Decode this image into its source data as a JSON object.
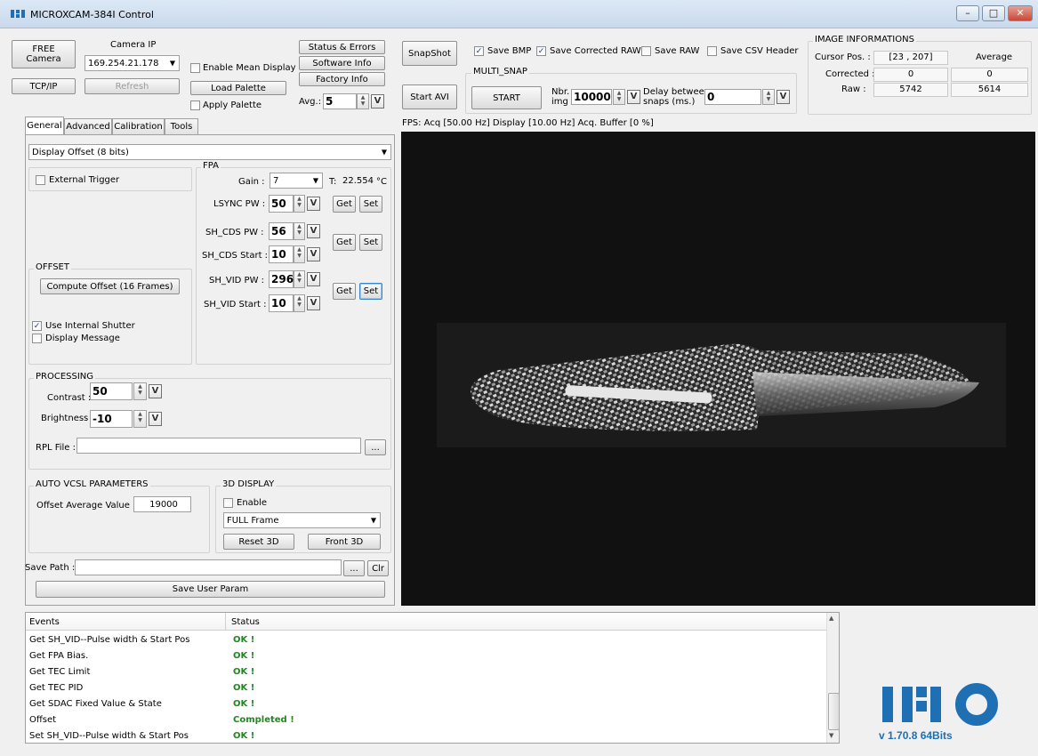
{
  "window": {
    "title": "MICROXCAM-384I Control",
    "minimize": "–",
    "maximize": "□",
    "close": "✕"
  },
  "camera": {
    "free_label": "FREE\nCamera",
    "ip_label": "Camera IP",
    "ip_value": "169.254.21.178",
    "tcpip_label": "TCP/IP",
    "refresh_label": "Refresh"
  },
  "top_buttons": {
    "status_errors": "Status & Errors",
    "software_info": "Software Info",
    "factory_info": "Factory Info",
    "load_palette": "Load Palette",
    "enable_mean": "Enable Mean Display",
    "apply_palette": "Apply Palette",
    "avg_label": "Avg.:",
    "avg_value": "5"
  },
  "snap": {
    "snapshot": "SnapShot",
    "start_avi": "Start AVI",
    "save_bmp": "Save BMP",
    "save_corrected_raw": "Save Corrected RAW",
    "save_raw": "Save RAW",
    "save_csv_header": "Save CSV Header",
    "multi_snap": "MULTI_SNAP",
    "start": "START",
    "nbr_img_label": "Nbr.\nimg",
    "nbr_img_value": "10000",
    "delay_label": "Delay between\nsnaps (ms.)",
    "delay_value": "0"
  },
  "image_info": {
    "title": "IMAGE INFORMATIONS",
    "cursor_label": "Cursor Pos. :",
    "cursor_value": "[23 , 207]",
    "average_label": "Average",
    "corrected_label": "Corrected :",
    "corrected_value": "0",
    "corrected_avg": "0",
    "raw_label": "Raw :",
    "raw_value": "5742",
    "raw_avg": "5614"
  },
  "fps": "FPS: Acq [50.00 Hz]   Display [10.00 Hz]   Acq. Buffer [0 %]",
  "tabs": [
    "General",
    "Advanced",
    "Calibration",
    "Tools"
  ],
  "display_mode": "Display Offset (8 bits)",
  "external_trigger": "External Trigger",
  "fpa": {
    "title": "FPA",
    "gain_label": "Gain :",
    "gain_value": "7",
    "temp_label": "T:",
    "temp_value": "22.554",
    "temp_unit": "°C",
    "lsync_label": "LSYNC PW :",
    "lsync_value": "50",
    "shcds_pw_label": "SH_CDS PW :",
    "shcds_pw_value": "56",
    "shcds_start_label": "SH_CDS Start :",
    "shcds_start_value": "10",
    "shvid_pw_label": "SH_VID PW :",
    "shvid_pw_value": "296",
    "shvid_start_label": "SH_VID Start :",
    "shvid_start_value": "10",
    "get": "Get",
    "set": "Set",
    "v": "V"
  },
  "offset": {
    "title": "OFFSET",
    "compute": "Compute Offset (16 Frames)",
    "use_internal_shutter": "Use Internal Shutter",
    "display_message": "Display Message"
  },
  "processing": {
    "title": "PROCESSING",
    "contrast_label": "Contrast :",
    "contrast_value": "50",
    "brightness_label": "Brightness :",
    "brightness_value": "-10",
    "rpl_label": "RPL File :",
    "rpl_value": "",
    "browse": "..."
  },
  "auto_vcsl": {
    "title": "AUTO VCSL PARAMETERS",
    "offset_avg_label": "Offset Average Value :",
    "offset_avg_value": "19000"
  },
  "display3d": {
    "title": "3D DISPLAY",
    "enable": "Enable",
    "frame": "FULL Frame",
    "reset": "Reset 3D",
    "front": "Front 3D"
  },
  "save": {
    "path_label": "Save Path :",
    "path_value": "",
    "browse": "...",
    "clr": "Clr",
    "save_user_param": "Save User Param"
  },
  "events": {
    "col_events": "Events",
    "col_status": "Status",
    "rows": [
      {
        "event": "Get SH_VID--Pulse width & Start Pos",
        "status": "OK !"
      },
      {
        "event": "Get FPA Bias.",
        "status": "OK !"
      },
      {
        "event": "Get TEC Limit",
        "status": "OK !"
      },
      {
        "event": "Get TEC PID",
        "status": "OK !"
      },
      {
        "event": "Get SDAC Fixed Value & State",
        "status": "OK !"
      },
      {
        "event": "Offset",
        "status": "Completed !"
      },
      {
        "event": "Set SH_VID--Pulse width & Start Pos",
        "status": "OK !"
      }
    ]
  },
  "logo": {
    "text": "INO",
    "version": "v 1.70.8  64Bits"
  },
  "colors": {
    "logo_blue": "#1f6fb4",
    "ok_green": "#1e8a1e"
  }
}
